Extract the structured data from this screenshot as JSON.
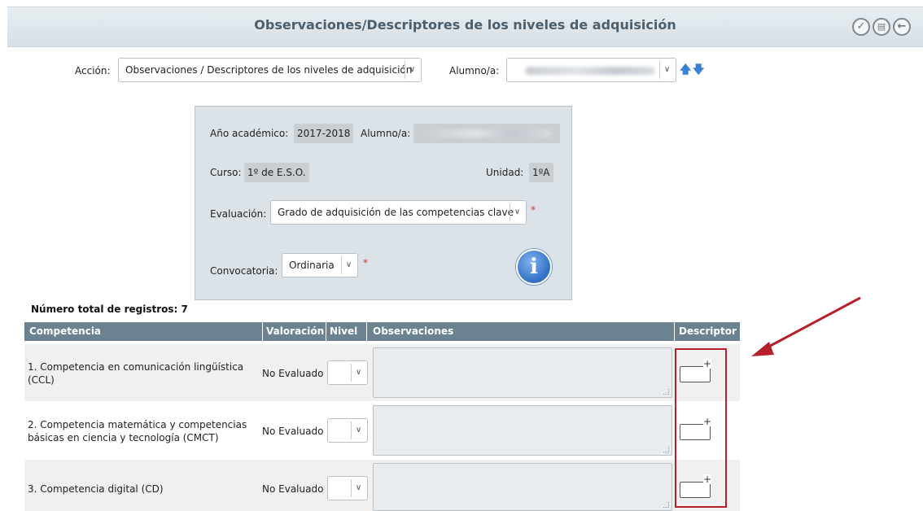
{
  "header": {
    "title": "Observaciones/Descriptores de los niveles de adquisición",
    "buttons": {
      "accept": "✓",
      "document": "▤",
      "back": "←"
    }
  },
  "toolbar": {
    "accion_label": "Acción:",
    "accion_value": "Observaciones / Descriptores de los niveles de adquisición",
    "alumno_label": "Alumno/a:",
    "alumno_value": "",
    "up_icon": "🡅",
    "down_icon": "🡇"
  },
  "panel": {
    "anio_label": "Año académico:",
    "anio_value": "2017-2018",
    "alumno_label": "Alumno/a:",
    "curso_label": "Curso:",
    "curso_value": "1º de E.S.O.",
    "unidad_label": "Unidad:",
    "unidad_value": "1ºA",
    "evaluacion_label": "Evaluación:",
    "evaluacion_value": "Grado de adquisición de las competencias clave",
    "convocatoria_label": "Convocatoria:",
    "convocatoria_value": "Ordinaria",
    "required_mark": "*",
    "info_icon": "i"
  },
  "table": {
    "total_label": "Número total de registros: 7",
    "columns": [
      "Competencia",
      "Valoración",
      "Nivel",
      "Observaciones",
      "Descriptor"
    ],
    "rows": [
      {
        "competencia": "1. Competencia en comunicación lingüística (CCL)",
        "valoracion": "No Evaluado"
      },
      {
        "competencia": "2. Competencia matemática y competencias básicas en ciencia y tecnología (CMCT)",
        "valoracion": "No Evaluado"
      },
      {
        "competencia": "3. Competencia digital (CD)",
        "valoracion": "No Evaluado"
      }
    ],
    "descriptor_plus": "+"
  },
  "colors": {
    "header_bg": "#d6dfe6",
    "table_header": "#6b8391",
    "highlight": "#b6202a",
    "panel_bg": "#dbe3e8"
  }
}
